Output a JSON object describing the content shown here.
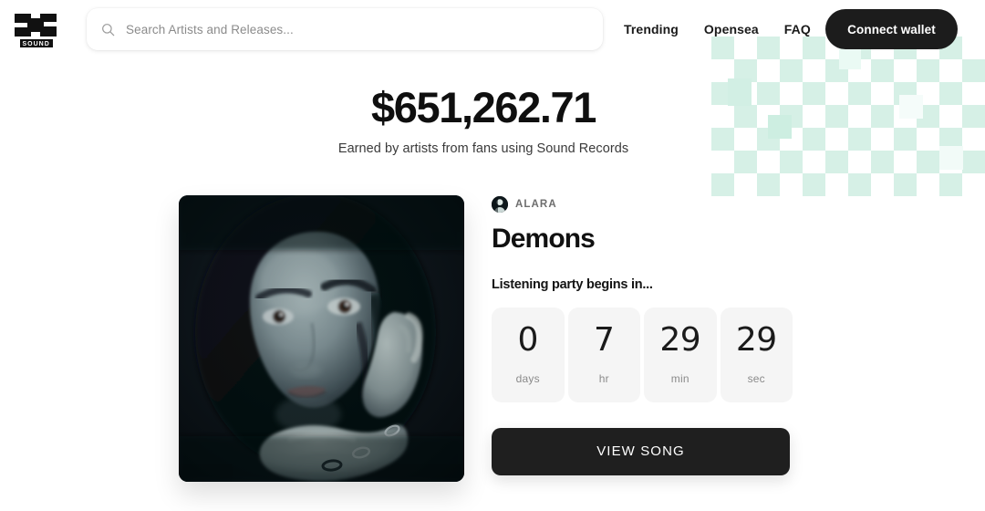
{
  "brand": {
    "logo_text": "SOUND",
    "logo_icon": "sound-s-monogram"
  },
  "search": {
    "placeholder": "Search Artists and Releases...",
    "value": "",
    "icon": "search-icon"
  },
  "nav": {
    "links": [
      {
        "label": "Trending"
      },
      {
        "label": "Opensea"
      },
      {
        "label": "FAQ"
      }
    ],
    "connect_wallet_label": "Connect wallet"
  },
  "earnings": {
    "amount": "$651,262.71",
    "caption": "Earned by artists from fans using Sound Records"
  },
  "release": {
    "artist_name": "ALARA",
    "artist_avatar_icon": "artist-avatar",
    "song_title": "Demons",
    "countdown_label": "Listening party begins in...",
    "countdown": [
      {
        "value": "0",
        "unit": "days"
      },
      {
        "value": "7",
        "unit": "hr"
      },
      {
        "value": "29",
        "unit": "min"
      },
      {
        "value": "29",
        "unit": "sec"
      }
    ],
    "view_song_label": "VIEW SONG",
    "artwork_alt": "Dark portrait of a woman resting her face on her hand"
  },
  "colors": {
    "background": "#ffffff",
    "text_primary": "#111111",
    "text_muted": "#8a8a8a",
    "button_dark": "#1f1f1f",
    "countdown_tile": "#f5f5f5",
    "decor_mint": "#dff3ec"
  }
}
